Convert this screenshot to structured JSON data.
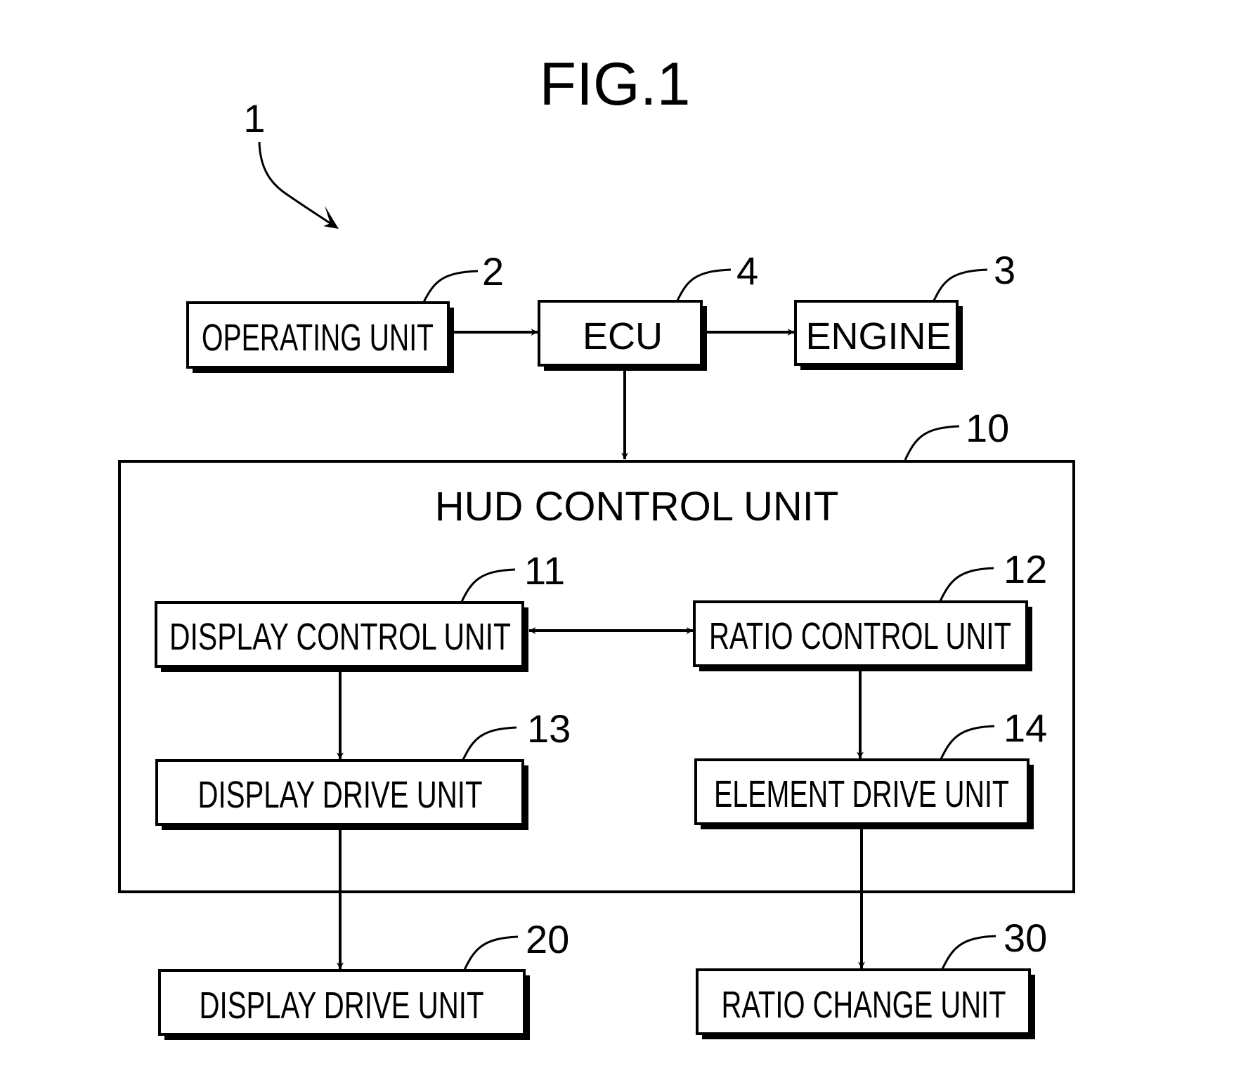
{
  "figure": {
    "title": "FIG.1",
    "system_ref": "1"
  },
  "blocks": {
    "operating_unit": {
      "label": "OPERATING UNIT",
      "ref": "2"
    },
    "ecu": {
      "label": "ECU",
      "ref": "4"
    },
    "engine": {
      "label": "ENGINE",
      "ref": "3"
    },
    "hud_control_unit": {
      "label": "HUD CONTROL UNIT",
      "ref": "10"
    },
    "display_control_unit": {
      "label": "DISPLAY CONTROL UNIT",
      "ref": "11"
    },
    "ratio_control_unit": {
      "label": "RATIO CONTROL UNIT",
      "ref": "12"
    },
    "display_drive_unit_inner": {
      "label": "DISPLAY DRIVE UNIT",
      "ref": "13"
    },
    "element_drive_unit": {
      "label": "ELEMENT DRIVE UNIT",
      "ref": "14"
    },
    "display_drive_unit_outer": {
      "label": "DISPLAY DRIVE UNIT",
      "ref": "20"
    },
    "ratio_change_unit": {
      "label": "RATIO CHANGE UNIT",
      "ref": "30"
    }
  },
  "connections": [
    {
      "from": "OPERATING UNIT",
      "to": "ECU",
      "type": "arrow"
    },
    {
      "from": "ECU",
      "to": "ENGINE",
      "type": "arrow"
    },
    {
      "from": "ECU",
      "to": "HUD CONTROL UNIT",
      "type": "arrow"
    },
    {
      "from": "DISPLAY CONTROL UNIT",
      "to": "RATIO CONTROL UNIT",
      "type": "bidirectional"
    },
    {
      "from": "DISPLAY CONTROL UNIT",
      "to": "DISPLAY DRIVE UNIT (13)",
      "type": "arrow"
    },
    {
      "from": "RATIO CONTROL UNIT",
      "to": "ELEMENT DRIVE UNIT",
      "type": "arrow"
    },
    {
      "from": "DISPLAY DRIVE UNIT (13)",
      "to": "DISPLAY DRIVE UNIT (20)",
      "type": "arrow"
    },
    {
      "from": "ELEMENT DRIVE UNIT",
      "to": "RATIO CHANGE UNIT",
      "type": "arrow"
    }
  ]
}
